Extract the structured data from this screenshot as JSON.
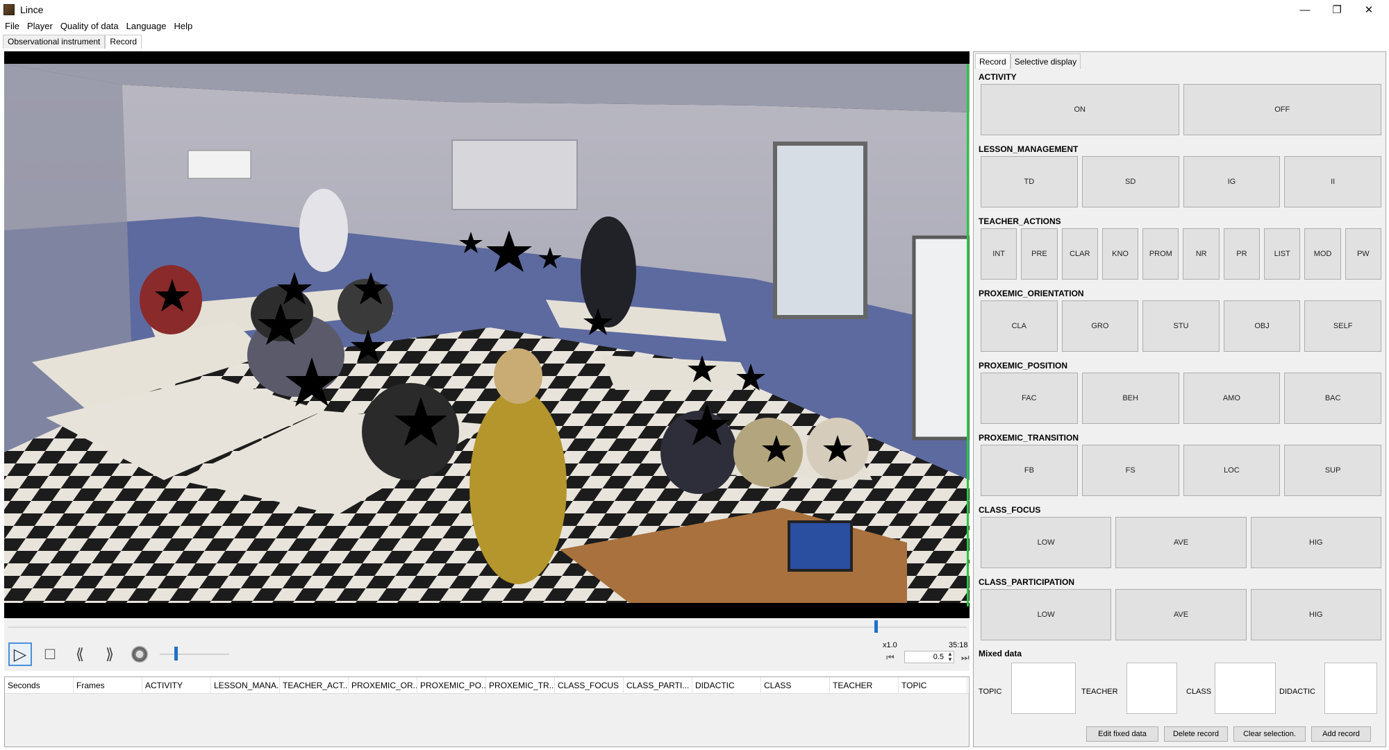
{
  "window": {
    "title": "Lince",
    "minimize": "—",
    "maximize": "❐",
    "close": "✕"
  },
  "menu": [
    "File",
    "Player",
    "Quality of data",
    "Language",
    "Help"
  ],
  "main_tabs": [
    {
      "label": "Observational instrument",
      "active": false
    },
    {
      "label": "Record",
      "active": true
    }
  ],
  "player": {
    "speed_label": "x1.0",
    "duration": "35:18",
    "speed_value": "0.5",
    "seek_position": 0.91,
    "volume_level": 0.2,
    "play_icon": "▷",
    "stop_icon": "□",
    "rewind_icon": "⟪",
    "forward_icon": "⟫",
    "volume_icon": "speaker-icon",
    "prev_frame_icon": "⏮",
    "next_frame_icon": "⏭"
  },
  "table": {
    "columns": [
      "Seconds",
      "Frames",
      "ACTIVITY",
      "LESSON_MANA...",
      "TEACHER_ACT...",
      "PROXEMIC_OR...",
      "PROXEMIC_PO...",
      "PROXEMIC_TR...",
      "CLASS_FOCUS",
      "CLASS_PARTI...",
      "DIDACTIC",
      "CLASS",
      "TEACHER",
      "TOPIC"
    ]
  },
  "right_panel": {
    "tabs": [
      {
        "label": "Record",
        "active": true
      },
      {
        "label": "Selective display",
        "active": false
      }
    ],
    "groups": [
      {
        "name": "ACTIVITY",
        "buttons": [
          "ON",
          "OFF"
        ]
      },
      {
        "name": "LESSON_MANAGEMENT",
        "buttons": [
          "TD",
          "SD",
          "IG",
          "II"
        ]
      },
      {
        "name": "TEACHER_ACTIONS",
        "buttons": [
          "INT",
          "PRE",
          "CLAR",
          "KNO",
          "PROM",
          "NR",
          "PR",
          "LIST",
          "MOD",
          "PW"
        ]
      },
      {
        "name": "PROXEMIC_ORIENTATION",
        "buttons": [
          "CLA",
          "GRO",
          "STU",
          "OBJ",
          "SELF"
        ]
      },
      {
        "name": "PROXEMIC_POSITION",
        "buttons": [
          "FAC",
          "BEH",
          "AMO",
          "BAC"
        ]
      },
      {
        "name": "PROXEMIC_TRANSITION",
        "buttons": [
          "FB",
          "FS",
          "LOC",
          "SUP"
        ]
      },
      {
        "name": "CLASS_FOCUS",
        "buttons": [
          "LOW",
          "AVE",
          "HIG"
        ]
      },
      {
        "name": "CLASS_PARTICIPATION",
        "buttons": [
          "LOW",
          "AVE",
          "HIG"
        ]
      }
    ],
    "mixed_data": {
      "title": "Mixed data",
      "fields": [
        "TOPIC",
        "TEACHER",
        "CLASS",
        "DIDACTIC"
      ]
    },
    "actions": {
      "edit_fixed": "Edit fixed data",
      "delete_record": "Delete record",
      "clear_selection": "Clear selection.",
      "add_record": "Add record"
    }
  }
}
